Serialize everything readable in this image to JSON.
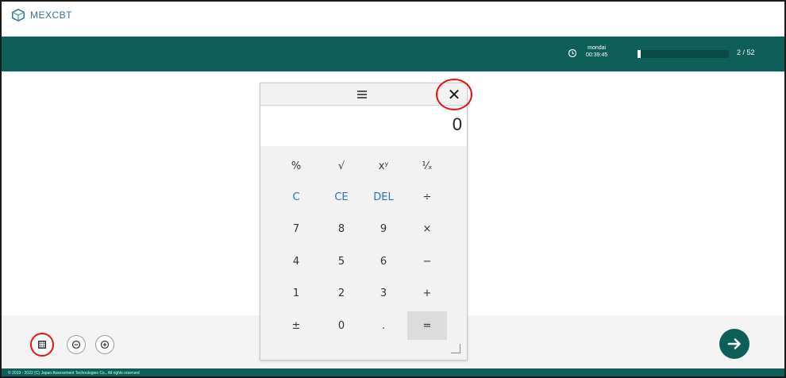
{
  "brand": {
    "name": "MEXCBT",
    "sub": ""
  },
  "header": {
    "timer_label": "mondai",
    "timer_value": "00:39:45",
    "progress_text": "2 / 52",
    "progress_fraction": 0.0385
  },
  "calculator": {
    "display_value": "0",
    "rows": [
      [
        "%",
        "√",
        "xʸ",
        "¹⁄ₓ"
      ],
      [
        "C",
        "CE",
        "DEL",
        "÷"
      ],
      [
        "7",
        "8",
        "9",
        "×"
      ],
      [
        "4",
        "5",
        "6",
        "−"
      ],
      [
        "1",
        "2",
        "3",
        "+"
      ],
      [
        "±",
        "0",
        ".",
        "="
      ]
    ]
  },
  "icons": {
    "menu": "hamburger-icon",
    "close": "close-icon",
    "timer": "clock-icon",
    "calculator": "calculator-icon",
    "zoom_out": "zoom-out-icon",
    "zoom_in": "zoom-in-icon",
    "next": "arrow-right-icon"
  },
  "footer": {
    "text": "© 2019 - 2022 (C) Japan Assessment Technologies Co., All rights reserved"
  },
  "colors": {
    "brand_teal": "#0e5e5a",
    "highlight_red": "#e11111",
    "key_blue": "#2a73b8"
  }
}
